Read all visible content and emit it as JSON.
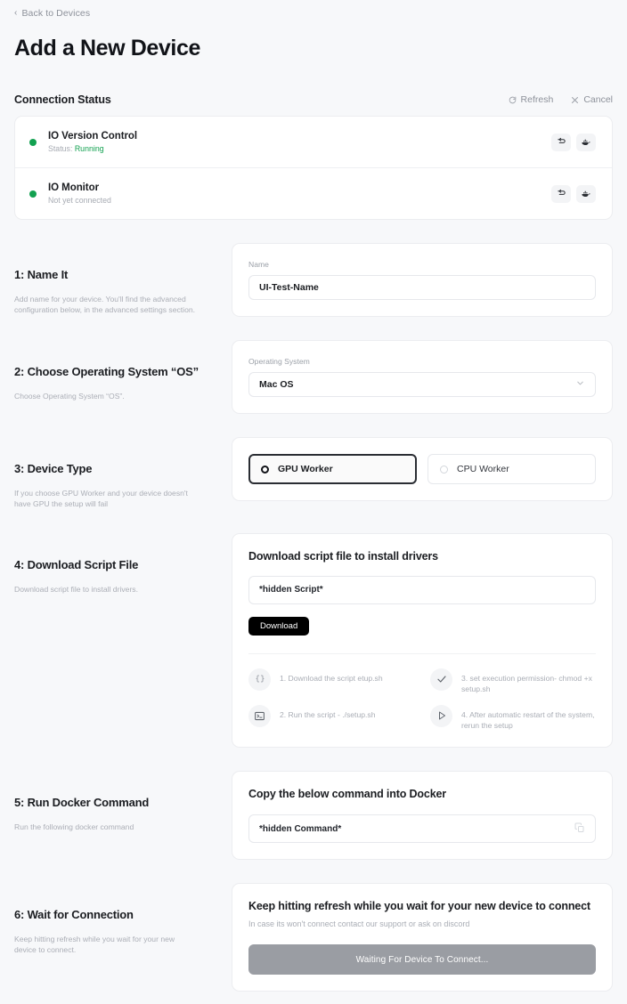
{
  "header": {
    "back_label": "Back to Devices",
    "back_icon": "chevron-left-icon",
    "title": "Add a New Device"
  },
  "connection_status": {
    "title": "Connection Status",
    "actions": [
      {
        "label": "Refresh",
        "icon": "refresh-icon"
      },
      {
        "label": "Cancel",
        "icon": "close-icon"
      }
    ],
    "rows": [
      {
        "name": "IO Version Control",
        "status_prefix": "Status: ",
        "status_value": "Running",
        "status_color": "#12a150",
        "dot_color": "#12a150",
        "icons": [
          "version-control-icon",
          "docker-whale-icon"
        ]
      },
      {
        "name": "IO Monitor",
        "status_prefix": "Not yet connected",
        "status_value": "",
        "status_color": "#a7abb3",
        "dot_color": "#12a150",
        "icons": [
          "version-control-icon",
          "docker-whale-icon"
        ]
      }
    ]
  },
  "steps": {
    "name_it": {
      "heading": "1: Name It",
      "description": "Add name for your device. You'll find the advanced configuration below, in the advanced settings section.",
      "field_label": "Name",
      "field_value": "UI-Test-Name",
      "field_placeholder": "Name"
    },
    "os": {
      "heading": "2: Choose Operating System “OS”",
      "description": "Choose Operating System “OS”.",
      "field_label": "Operating System",
      "selected": "Mac OS",
      "chevron_icon": "chevron-down-icon"
    },
    "device_type": {
      "heading": "3: Device Type",
      "description": "If you choose GPU Worker and your device doesn't have GPU the setup will fail",
      "options": [
        {
          "label": "GPU Worker",
          "selected": true
        },
        {
          "label": "CPU Worker",
          "selected": false
        }
      ]
    },
    "download": {
      "heading": "4: Download Script File",
      "description": "Download script file to install drivers.",
      "panel_title": "Download script file to install drivers",
      "script_value": "*hidden Script*",
      "button_label": "Download",
      "hints": [
        {
          "icon": "braces-icon",
          "text": "1. Download the script etup.sh"
        },
        {
          "icon": "check-icon",
          "text": "3. set execution permission- chmod +x setup.sh"
        },
        {
          "icon": "terminal-icon",
          "text": "2. Run the script - ./setup.sh"
        },
        {
          "icon": "play-icon",
          "text": "4. After automatic restart of the system, rerun the setup"
        }
      ]
    },
    "docker": {
      "heading": "5: Run Docker Command",
      "description": "Run the following docker command",
      "panel_title": "Copy the below command into Docker",
      "command_value": "*hidden Command*",
      "copy_icon": "copy-icon"
    },
    "wait": {
      "heading": "6: Wait for Connection",
      "description": "Keep hitting refresh while you wait for your new device to connect.",
      "panel_title": "Keep hitting refresh while you wait for your new device to connect",
      "panel_subtitle": "In case its won't connect contact our support or ask on discord",
      "button_label": "Waiting For Device To Connect...",
      "button_color": "#9a9da3"
    }
  }
}
